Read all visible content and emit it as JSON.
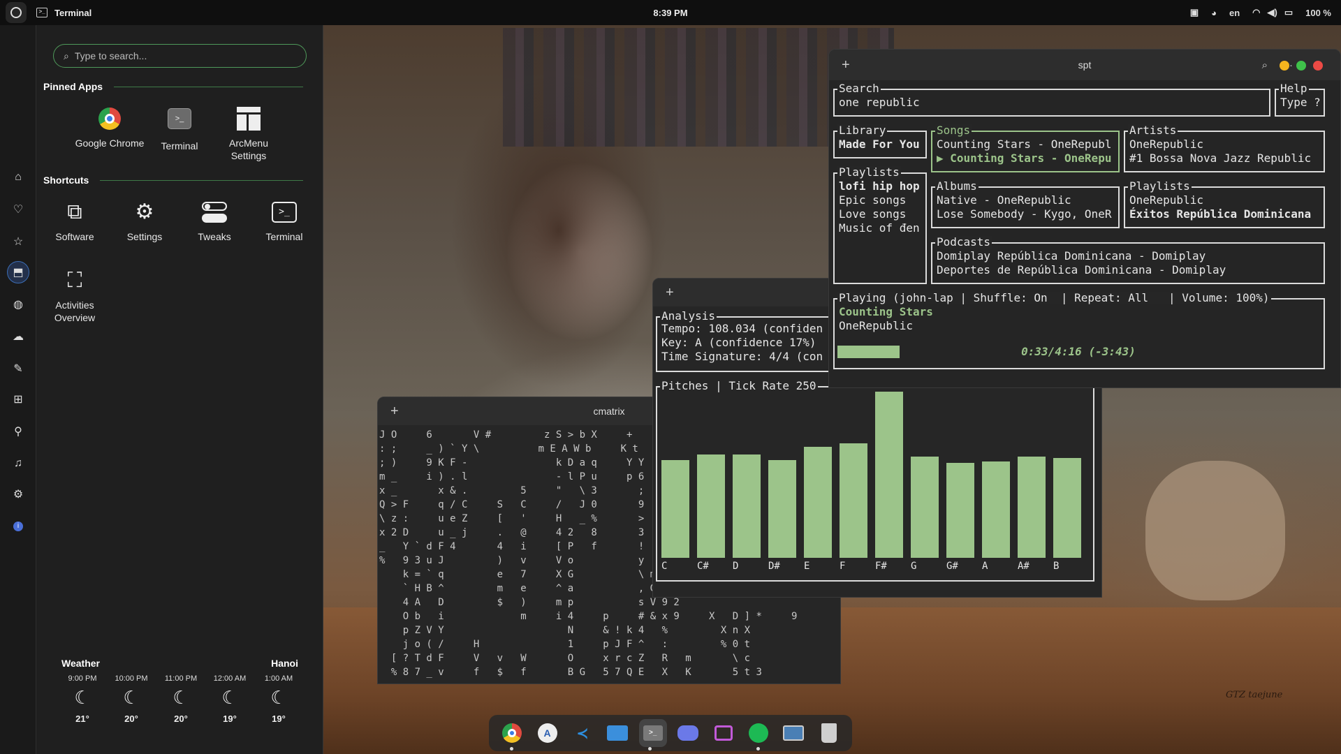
{
  "topbar": {
    "app_name": "Terminal",
    "clock": "8:39 PM",
    "language": "en",
    "battery": "100 %"
  },
  "arcmenu": {
    "search_placeholder": "Type to search...",
    "pinned_title": "Pinned Apps",
    "pinned": [
      {
        "label": "Google Chrome"
      },
      {
        "label": "Terminal"
      },
      {
        "label": "ArcMenu Settings"
      }
    ],
    "shortcuts_title": "Shortcuts",
    "shortcuts": [
      {
        "label": "Software"
      },
      {
        "label": "Settings"
      },
      {
        "label": "Tweaks"
      },
      {
        "label": "Terminal"
      },
      {
        "label": "Activities Overview"
      }
    ]
  },
  "weather": {
    "title": "Weather",
    "city": "Hanoi",
    "hours": [
      {
        "time": "9:00 PM",
        "temp": "21°"
      },
      {
        "time": "10:00 PM",
        "temp": "20°"
      },
      {
        "time": "11:00 PM",
        "temp": "20°"
      },
      {
        "time": "12:00 AM",
        "temp": "19°"
      },
      {
        "time": "1:00 AM",
        "temp": "19°"
      }
    ]
  },
  "cmatrix": {
    "title": "cmatrix",
    "lines": [
      "J O     6       V #         z S > b X     +",
      ": ;     _ ) ` Y \\          m E A W b     K t",
      "; )     9 K F -               k D a q     Y Y",
      "m _     i ) . l               - l P u     p 6",
      "x _       x & .         5     \"   \\ 3       ;",
      "Q > F     q / C     S   C     /   J 0       9",
      "\\ z :     u e Z     [   '     H   _ %       >",
      "x 2 D     u _ j     .   @     4 2   8       3",
      "_   Y ` d F 4       4   i     [ P   f       !",
      "%   9 3 u J         )   v     V o           y",
      "    k = ` q         e   7     X G           \\ m",
      "    ` H B ^         m   e     ^ a           , G",
      "    4 A   D         $   )     m p           s V 9 2",
      "    O b   i             m     i 4     p     # & x 9     X   D ] *     9",
      "    p Z V Y                     N     & ! k 4   %         X n X",
      "    j o ( /     H               1     p J F ^   :         % 0 t",
      "  [ ? T d F     V   v   W       O     x r c Z   R   m       \\ c",
      "  % 8 7 _ v     f   $   f       B G   5 7 Q E   X   K       5 t 3"
    ]
  },
  "analysis": {
    "box_label": "Analysis",
    "tempo": "Tempo: 108.034 (confiden",
    "key": "Key: A (confidence 17%)",
    "time_signature": "Time Signature: 4/4 (con",
    "pitches_label": "Pitches | Tick Rate 250"
  },
  "chart_data": {
    "type": "bar",
    "categories": [
      "C",
      "C#",
      "D",
      "D#",
      "E",
      "F",
      "F#",
      "G",
      "G#",
      "A",
      "A#",
      "B"
    ],
    "values": [
      0.59,
      0.62,
      0.62,
      0.59,
      0.67,
      0.69,
      1.0,
      0.61,
      0.57,
      0.58,
      0.61,
      0.6
    ],
    "color": "#9cc48a"
  },
  "spt": {
    "title": "spt",
    "search_label": "Search",
    "search_value": "one republic",
    "help_label": "Help",
    "help_value": "Type ?",
    "library_label": "Library",
    "library_items": [
      "Made For You"
    ],
    "playlists_label": "Playlists",
    "playlists": [
      "lofi hip hop",
      "Epic songs",
      "Love songs",
      "Music of đen"
    ],
    "songs_label": "Songs",
    "songs": [
      "Counting Stars - OneRepubl",
      "▶ Counting Stars - OneRepu"
    ],
    "artists_label": "Artists",
    "artists": [
      "OneRepublic",
      "#1 Bossa Nova Jazz Republic"
    ],
    "albums_label": "Albums",
    "albums": [
      "Native - OneRepublic",
      "Lose Somebody - Kygo, OneR"
    ],
    "result_playlists_label": "Playlists",
    "result_playlists": [
      "OneRepublic",
      "Éxitos República Dominicana"
    ],
    "podcasts_label": "Podcasts",
    "podcasts": [
      "Domiplay República Dominicana - Domiplay",
      "Deportes de República Dominicana - Domiplay"
    ],
    "playing_label": "Playing (john-lap | Shuffle: On  | Repeat: All   | Volume: 100%)",
    "now_title": "Counting Stars",
    "now_artist": "OneRepublic",
    "progress_text": "0:33/4:16 (-3:43)",
    "progress_fraction": 0.129
  },
  "wallpaper": {
    "signature": "GTZ taejune"
  },
  "dock": {
    "items": [
      "chrome-icon",
      "software-icon",
      "vscode-icon",
      "files-icon",
      "terminal-icon",
      "discord-icon",
      "screenshot-icon",
      "spotify-icon",
      "remote-desktop-icon",
      "trash-icon"
    ]
  }
}
